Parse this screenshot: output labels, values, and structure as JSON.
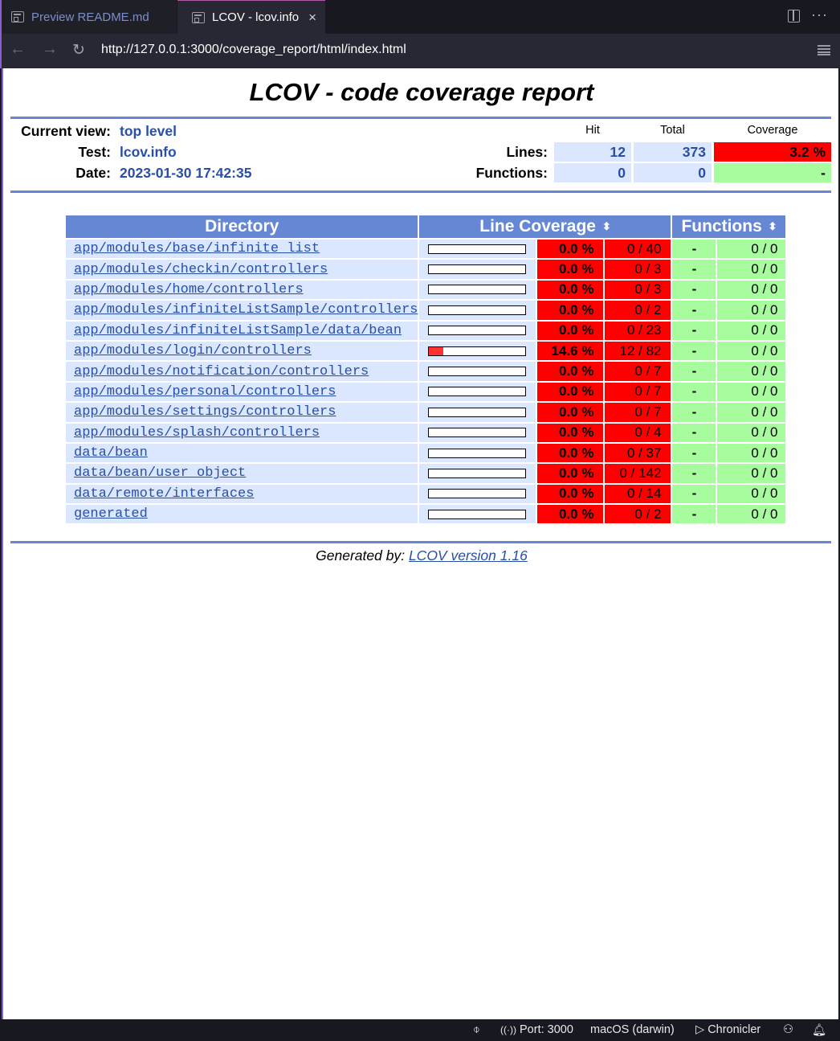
{
  "tabs": [
    {
      "label": "Preview README.md",
      "active": false,
      "icon": "preview-icon"
    },
    {
      "label": "LCOV - lcov.info",
      "active": true,
      "icon": "preview-icon"
    }
  ],
  "tab_close": "×",
  "tab_actions": {
    "split": "split-editor-icon",
    "more": "···"
  },
  "address_bar": {
    "back": "←",
    "forward": "→",
    "reload": "↻",
    "url": "http://127.0.0.1:3000/coverage_report/html/index.html"
  },
  "report": {
    "title": "LCOV - code coverage report",
    "info": [
      {
        "label": "Current view:",
        "value": "top level"
      },
      {
        "label": "Test:",
        "value": "lcov.info"
      },
      {
        "label": "Date:",
        "value": "2023-01-30 17:42:35"
      }
    ],
    "summary": {
      "headers": [
        "Hit",
        "Total",
        "Coverage"
      ],
      "rows": [
        {
          "label": "Lines:",
          "hit": "12",
          "total": "373",
          "coverage": "3.2 %",
          "status": "low"
        },
        {
          "label": "Functions:",
          "hit": "0",
          "total": "0",
          "coverage": "-",
          "status": "none"
        }
      ]
    },
    "table": {
      "headers": {
        "directory": "Directory",
        "line_coverage": "Line Coverage",
        "functions": "Functions",
        "sort_icon": "⬍"
      },
      "rows": [
        {
          "dir": "app/modules/base/infinite_list",
          "line_fraction": 0.0,
          "line_pct": "0.0 %",
          "line_count": "0 / 40",
          "func_pct": "-",
          "func_count": "0 / 0"
        },
        {
          "dir": "app/modules/checkin/controllers",
          "line_fraction": 0.0,
          "line_pct": "0.0 %",
          "line_count": "0 / 3",
          "func_pct": "-",
          "func_count": "0 / 0"
        },
        {
          "dir": "app/modules/home/controllers",
          "line_fraction": 0.0,
          "line_pct": "0.0 %",
          "line_count": "0 / 3",
          "func_pct": "-",
          "func_count": "0 / 0"
        },
        {
          "dir": "app/modules/infiniteListSample/controllers",
          "line_fraction": 0.0,
          "line_pct": "0.0 %",
          "line_count": "0 / 2",
          "func_pct": "-",
          "func_count": "0 / 0"
        },
        {
          "dir": "app/modules/infiniteListSample/data/bean",
          "line_fraction": 0.0,
          "line_pct": "0.0 %",
          "line_count": "0 / 23",
          "func_pct": "-",
          "func_count": "0 / 0"
        },
        {
          "dir": "app/modules/login/controllers",
          "line_fraction": 0.146,
          "line_pct": "14.6 %",
          "line_count": "12 / 82",
          "func_pct": "-",
          "func_count": "0 / 0"
        },
        {
          "dir": "app/modules/notification/controllers",
          "line_fraction": 0.0,
          "line_pct": "0.0 %",
          "line_count": "0 / 7",
          "func_pct": "-",
          "func_count": "0 / 0"
        },
        {
          "dir": "app/modules/personal/controllers",
          "line_fraction": 0.0,
          "line_pct": "0.0 %",
          "line_count": "0 / 7",
          "func_pct": "-",
          "func_count": "0 / 0"
        },
        {
          "dir": "app/modules/settings/controllers",
          "line_fraction": 0.0,
          "line_pct": "0.0 %",
          "line_count": "0 / 7",
          "func_pct": "-",
          "func_count": "0 / 0"
        },
        {
          "dir": "app/modules/splash/controllers",
          "line_fraction": 0.0,
          "line_pct": "0.0 %",
          "line_count": "0 / 4",
          "func_pct": "-",
          "func_count": "0 / 0"
        },
        {
          "dir": "data/bean",
          "line_fraction": 0.0,
          "line_pct": "0.0 %",
          "line_count": "0 / 37",
          "func_pct": "-",
          "func_count": "0 / 0"
        },
        {
          "dir": "data/bean/user_object",
          "line_fraction": 0.0,
          "line_pct": "0.0 %",
          "line_count": "0 / 142",
          "func_pct": "-",
          "func_count": "0 / 0"
        },
        {
          "dir": "data/remote/interfaces",
          "line_fraction": 0.0,
          "line_pct": "0.0 %",
          "line_count": "0 / 14",
          "func_pct": "-",
          "func_count": "0 / 0"
        },
        {
          "dir": "generated",
          "line_fraction": 0.0,
          "line_pct": "0.0 %",
          "line_count": "0 / 2",
          "func_pct": "-",
          "func_count": "0 / 0"
        }
      ]
    },
    "footer": {
      "prefix": "Generated by: ",
      "link": "LCOV version 1.16"
    }
  },
  "colors": {
    "rule": "#6688d4",
    "low": "#ff0000",
    "none": "#a7fc9d",
    "bar_fill": "#ff3131",
    "link": "#284fa8"
  },
  "status_bar": {
    "port": "Port: 3000",
    "os": "macOS (darwin)",
    "chronicler": "Chronicler"
  }
}
